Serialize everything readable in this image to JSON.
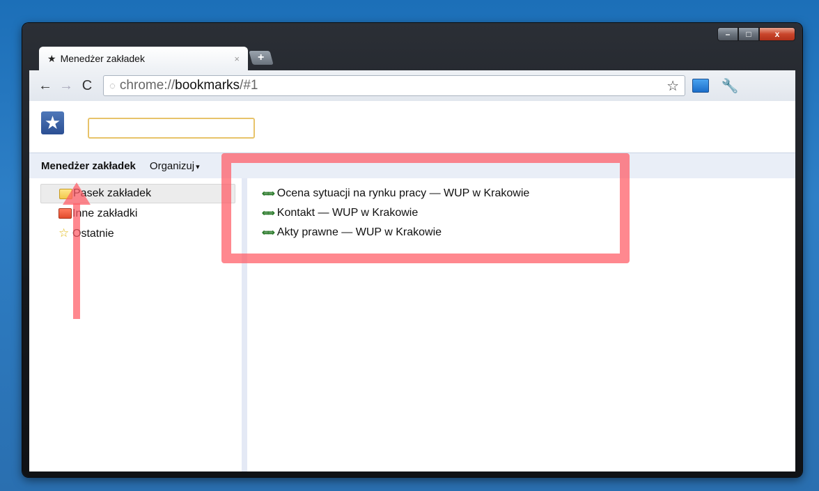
{
  "tab": {
    "title": "Menedżer zakładek",
    "close": "×",
    "star": "★"
  },
  "new_tab": "+",
  "window_controls": {
    "minimize": "–",
    "maximize": "□",
    "close": "x"
  },
  "toolbar": {
    "back": "←",
    "forward": "→",
    "reload": "C",
    "url_scheme": "chrome://",
    "url_host": "bookmarks",
    "url_path": "/#1",
    "star": "☆",
    "wrench": "🔧"
  },
  "search": {
    "value": "",
    "placeholder": ""
  },
  "menu": {
    "title": "Menedżer zakładek",
    "organize": "Organizuj",
    "caret": "▾"
  },
  "tree": [
    {
      "label": "Pasek zakładek",
      "icon": "folder-icon",
      "selected": true
    },
    {
      "label": "Inne zakładki",
      "icon": "folder-icon"
    },
    {
      "label": "Ostatnie",
      "icon": "star-icon"
    }
  ],
  "bookmarks": [
    {
      "title": "Ocena sytuacji na rynku pracy — WUP w Krakowie",
      "icon": "link-icon"
    },
    {
      "title": "Kontakt — WUP w Krakowie",
      "icon": "link-icon"
    },
    {
      "title": "Akty prawne — WUP w Krakowie",
      "icon": "link-icon"
    }
  ],
  "colors": {
    "annotation": "#ff5a64",
    "desktop": "#2a76bd"
  }
}
